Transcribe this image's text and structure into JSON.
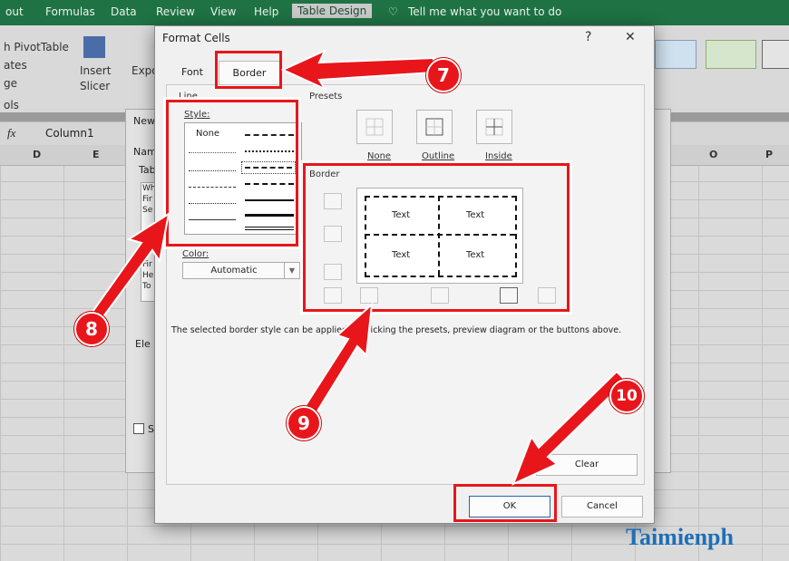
{
  "ribbon": {
    "tabs": [
      "out",
      "Formulas",
      "Data",
      "Review",
      "View",
      "Help",
      "Table Design"
    ],
    "tell_me": "Tell me what you want to do",
    "group_labels": [
      "h PivotTable",
      "ates",
      "ge",
      "ols"
    ],
    "insert_slicer": "Insert\nSlicer",
    "export": "Expo",
    "name_box": "Column1",
    "fx": "fx"
  },
  "sheet": {
    "columns_left": [
      "D",
      "E"
    ],
    "columns_right": [
      "O",
      "P"
    ]
  },
  "background_dialog": {
    "title": "New",
    "fragments": [
      "Nam",
      "Tab",
      "Wh",
      "Fir",
      "Se",
      "Fir",
      "He",
      "To",
      "Ele",
      "S"
    ]
  },
  "dialog": {
    "title": "Format Cells",
    "help": "?",
    "close": "✕",
    "tabs": [
      "Font",
      "Border"
    ],
    "line_section": "Line",
    "style_label": "Style:",
    "style_none": "None",
    "color_label": "Color:",
    "color_value": "Automatic",
    "presets_section": "Presets",
    "presets": [
      "None",
      "Outline",
      "Inside"
    ],
    "border_section": "Border",
    "preview_text": [
      "Text",
      "Text",
      "Text",
      "Text"
    ],
    "hint": "The selected border style can be applied by clicking the presets, preview diagram or the buttons above.",
    "clear_button": "Clear",
    "ok_button": "OK",
    "cancel_button": "Cancel"
  },
  "annotations": {
    "badges": [
      "7",
      "8",
      "9",
      "10"
    ],
    "highlight_color": "#e8161b"
  },
  "watermark": "Taimienph"
}
